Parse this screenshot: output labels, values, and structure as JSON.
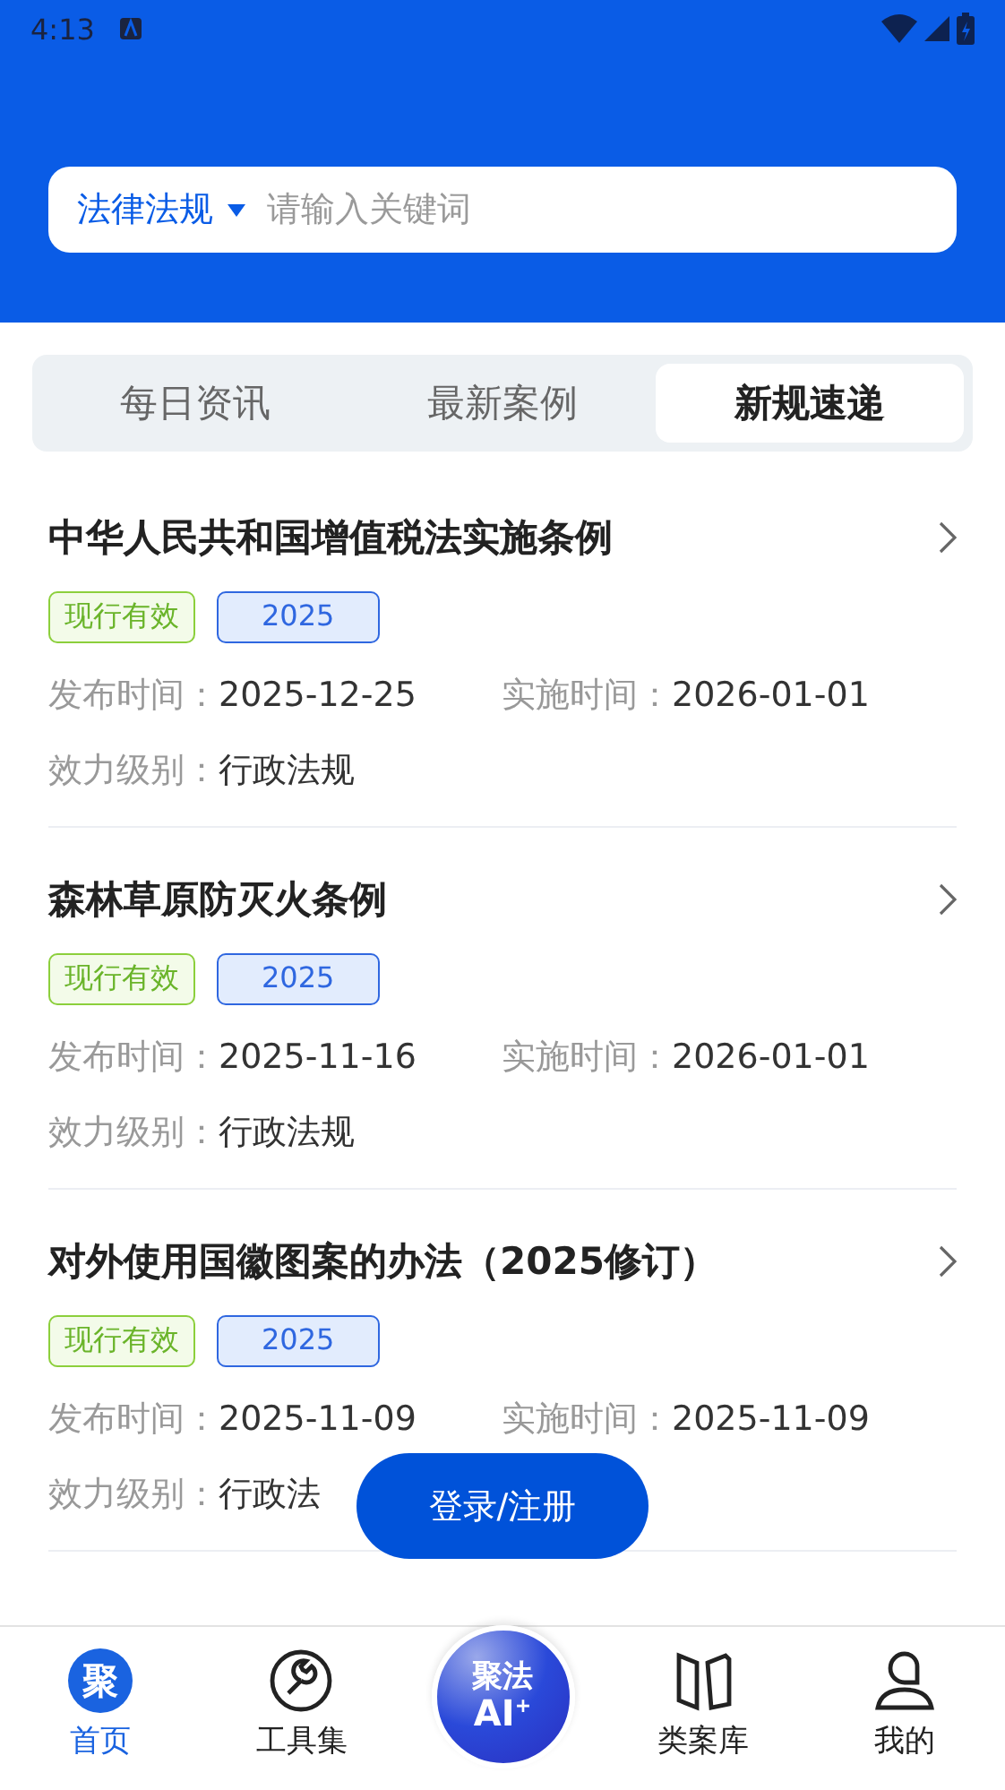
{
  "status_bar": {
    "time": "4:13"
  },
  "search": {
    "category": "法律法规",
    "placeholder": "请输入关键词"
  },
  "tabs": [
    {
      "label": "每日资讯",
      "selected": false
    },
    {
      "label": "最新案例",
      "selected": false
    },
    {
      "label": "新规速递",
      "selected": true
    }
  ],
  "items": [
    {
      "title": "中华人民共和国增值税法实施条例",
      "status": "现行有效",
      "year": "2025",
      "publish_label": "发布时间：",
      "publish_date": "2025-12-25",
      "effective_label": "实施时间：",
      "effective_date": "2026-01-01",
      "level_label": "效力级别：",
      "level": "行政法规"
    },
    {
      "title": "森林草原防灭火条例",
      "status": "现行有效",
      "year": "2025",
      "publish_label": "发布时间：",
      "publish_date": "2025-11-16",
      "effective_label": "实施时间：",
      "effective_date": "2026-01-01",
      "level_label": "效力级别：",
      "level": "行政法规"
    },
    {
      "title": "对外使用国徽图案的办法（2025修订）",
      "status": "现行有效",
      "year": "2025",
      "publish_label": "发布时间：",
      "publish_date": "2025-11-09",
      "effective_label": "实施时间：",
      "effective_date": "2025-11-09",
      "level_label": "效力级别：",
      "level": "行政法"
    }
  ],
  "login_button": "登录/注册",
  "nav": [
    {
      "kind": "home",
      "label": "首页",
      "icon_text": "聚",
      "selected": true
    },
    {
      "kind": "tools",
      "label": "工具集",
      "selected": false
    },
    {
      "kind": "ai",
      "line1": "聚法",
      "line2": "AI",
      "sup": "+"
    },
    {
      "kind": "cases",
      "label": "类案库",
      "selected": false
    },
    {
      "kind": "me",
      "label": "我的",
      "selected": false
    }
  ]
}
